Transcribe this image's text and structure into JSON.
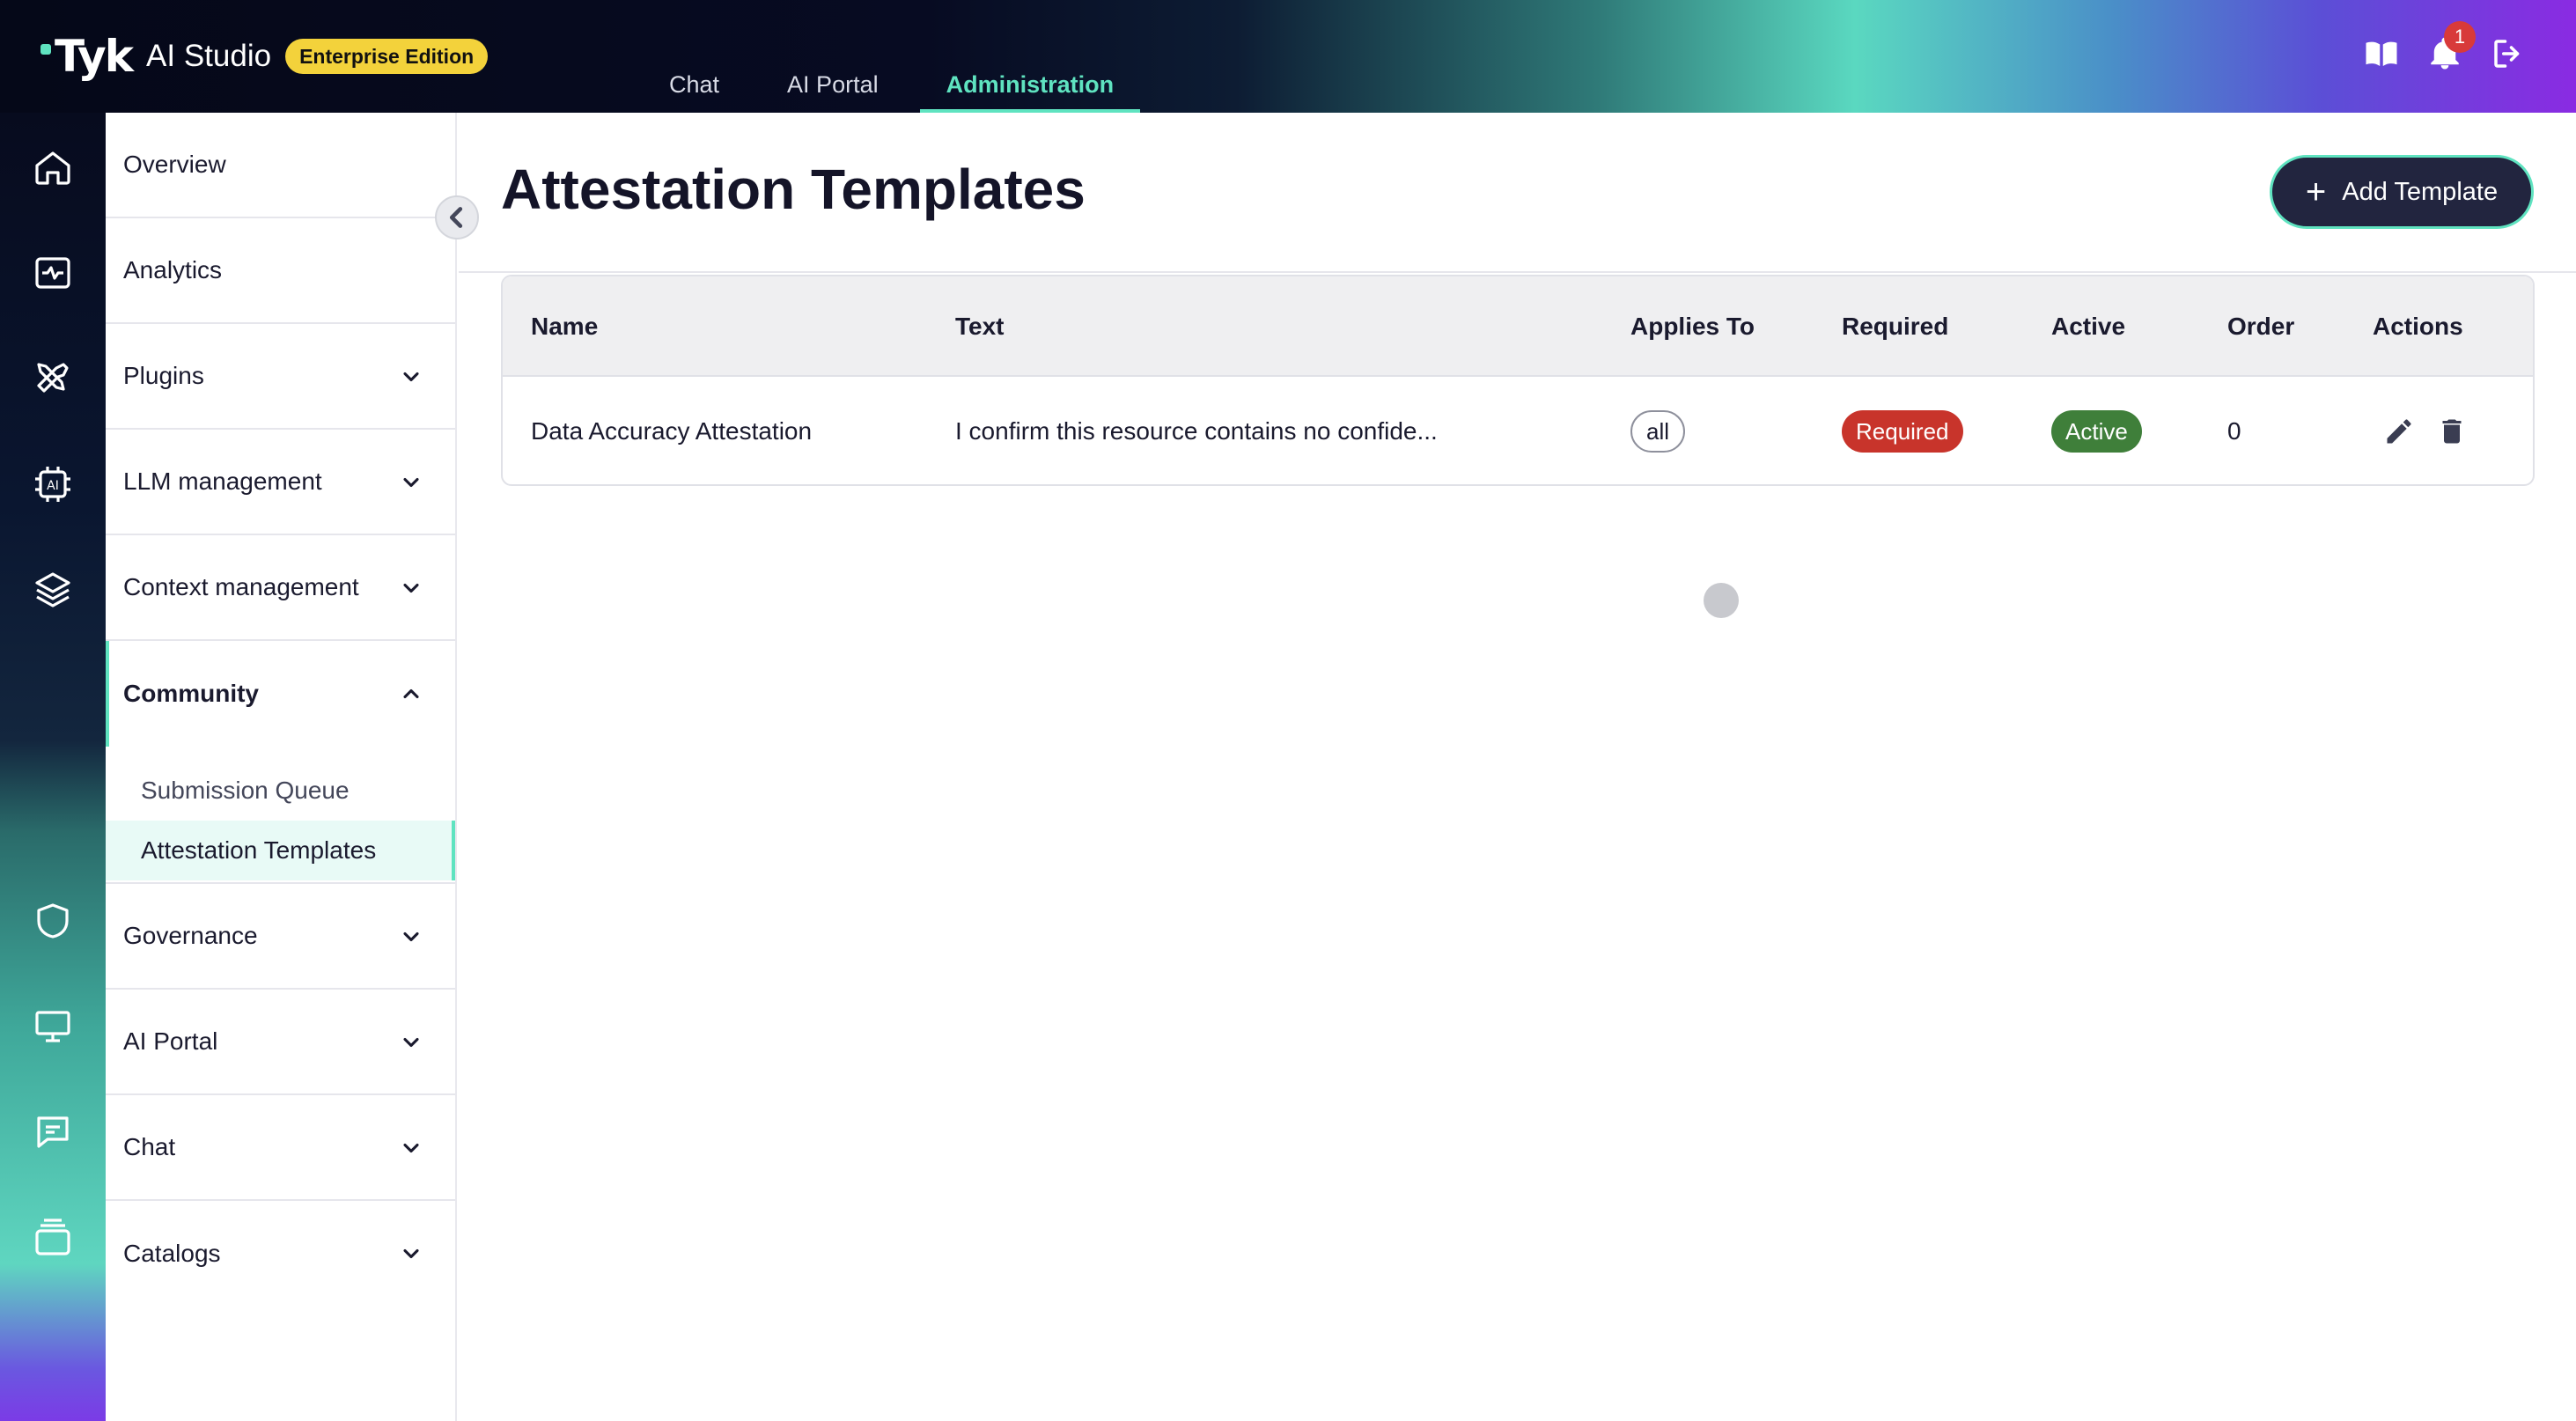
{
  "header": {
    "logo_text": "Tyk",
    "product": "AI Studio",
    "edition": "Enterprise Edition",
    "nav": [
      {
        "label": "Chat",
        "active": false
      },
      {
        "label": "AI Portal",
        "active": false
      },
      {
        "label": "Administration",
        "active": true
      }
    ],
    "icons": [
      "docs-book-icon",
      "notification-bell-icon",
      "logout-icon"
    ],
    "notification_count": "1"
  },
  "rail": {
    "icons": [
      "home-icon",
      "analytics-icon",
      "tools-icon",
      "ai-chip-icon",
      "layers-icon",
      "shield-icon",
      "monitor-icon",
      "chat-icon",
      "catalog-icon"
    ]
  },
  "sidebar": {
    "items": [
      {
        "label": "Overview",
        "has_chevron": false
      },
      {
        "label": "Analytics",
        "has_chevron": false
      },
      {
        "label": "Plugins",
        "has_chevron": true
      },
      {
        "label": "LLM management",
        "has_chevron": true
      },
      {
        "label": "Context management",
        "has_chevron": true
      },
      {
        "label": "Community",
        "has_chevron": true,
        "expanded": true
      },
      {
        "label": "Governance",
        "has_chevron": true
      },
      {
        "label": "AI Portal",
        "has_chevron": true
      },
      {
        "label": "Chat",
        "has_chevron": true
      },
      {
        "label": "Catalogs",
        "has_chevron": true
      }
    ],
    "community_sub": [
      {
        "label": "Submission Queue",
        "active": false
      },
      {
        "label": "Attestation Templates",
        "active": true
      }
    ]
  },
  "main": {
    "title": "Attestation Templates",
    "add_button": "Add Template",
    "table": {
      "columns": [
        "Name",
        "Text",
        "Applies To",
        "Required",
        "Active",
        "Order",
        "Actions"
      ],
      "rows": [
        {
          "name": "Data Accuracy Attestation",
          "text": "I confirm this resource contains no confide...",
          "applies_to": "all",
          "required": "Required",
          "active": "Active",
          "order": "0"
        }
      ]
    }
  },
  "colors": {
    "accent": "#5fe3c0",
    "primary_button": "#22253f",
    "required_pill": "#c8342b",
    "active_pill": "#3f7f3a",
    "edition_badge": "#f3d23b"
  }
}
